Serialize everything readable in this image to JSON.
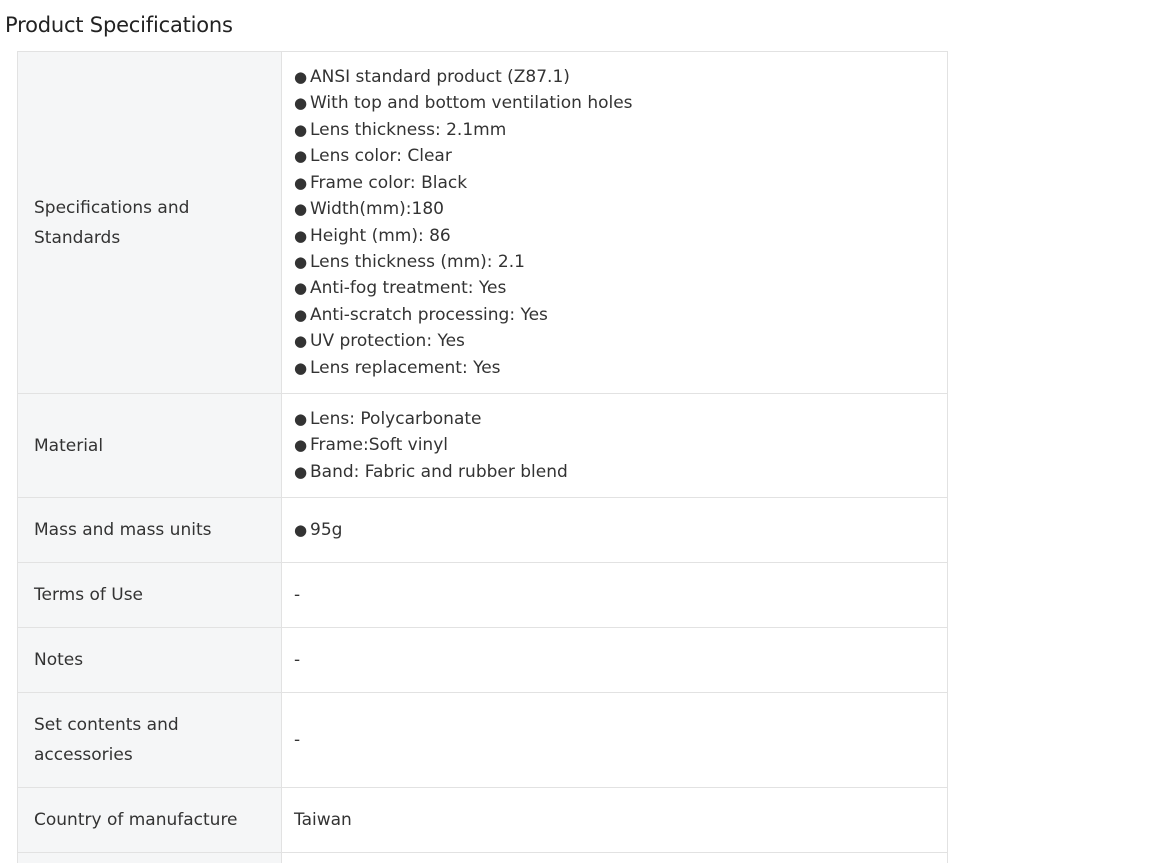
{
  "title": "Product Specifications",
  "rows": [
    {
      "label": "Specifications and Standards",
      "lines": [
        "ANSI standard product (Z87.1)",
        "With top and bottom ventilation holes",
        "Lens thickness: 2.1mm",
        "Lens color: Clear",
        "Frame color: Black",
        "Width(mm):180",
        "Height (mm): 86",
        "Lens thickness (mm): 2.1",
        "Anti-fog treatment: Yes",
        "Anti-scratch processing: Yes",
        "UV protection: Yes",
        "Lens replacement: Yes"
      ]
    },
    {
      "label": "Material",
      "lines": [
        "Lens: Polycarbonate",
        "Frame:Soft vinyl",
        "Band: Fabric and rubber blend"
      ]
    },
    {
      "label": "Mass and mass units",
      "lines": [
        "95g"
      ]
    },
    {
      "label": "Terms of Use",
      "value": "-"
    },
    {
      "label": "Notes",
      "value": "-"
    },
    {
      "label": "Set contents and accessories",
      "value": "-"
    },
    {
      "label": "Country of manufacture",
      "value": "Taiwan"
    },
    {
      "label": "",
      "value": ""
    }
  ],
  "bullet_glyph": "●"
}
